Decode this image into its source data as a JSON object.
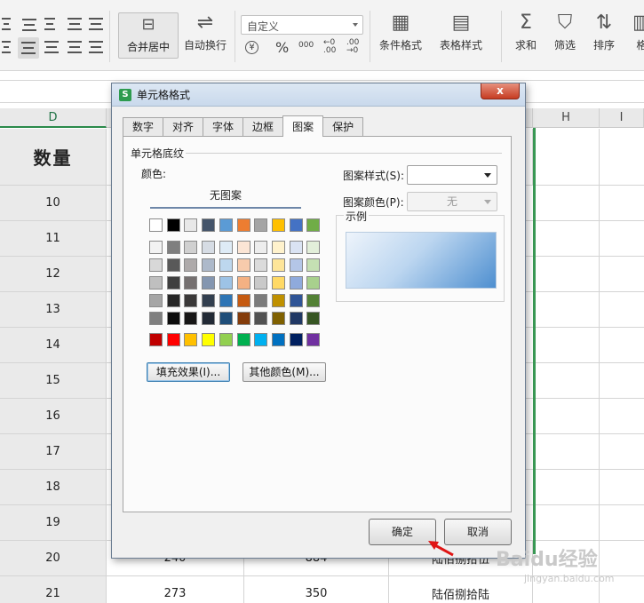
{
  "ribbon": {
    "merge_label": "合并居中",
    "autowrap_label": "自动换行",
    "number_format": "自定义",
    "currency_symbol": "¥",
    "percent_symbol": "%",
    "thousands_symbol": "000",
    "cond_format_label": "条件格式",
    "table_style_label": "表格样式",
    "sum_label": "求和",
    "filter_label": "筛选",
    "sort_label": "排序",
    "format_label": "格"
  },
  "columns": [
    "D",
    "H",
    "I"
  ],
  "sheet": {
    "header": "数量",
    "rows": [
      {
        "num": "10"
      },
      {
        "num": "11"
      },
      {
        "num": "12"
      },
      {
        "num": "13"
      },
      {
        "num": "14"
      },
      {
        "num": "15"
      },
      {
        "num": "16"
      },
      {
        "num": "17"
      },
      {
        "num": "18"
      },
      {
        "num": "19"
      },
      {
        "num": "20",
        "e": "240",
        "f": "884",
        "g": "陆佰捌拾伍"
      },
      {
        "num": "21",
        "e": "273",
        "f": "350",
        "g": "陆佰捌拾陆"
      }
    ]
  },
  "dialog": {
    "title": "单元格格式",
    "close": "x",
    "tabs": [
      "数字",
      "对齐",
      "字体",
      "边框",
      "图案",
      "保护"
    ],
    "active_tab": "图案",
    "group_title": "单元格底纹",
    "color_label": "颜色:",
    "no_pattern": "无图案",
    "palette": {
      "top": [
        "#ffffff",
        "#000000",
        "#e8e8e8",
        "#44546a",
        "#5b9bd5",
        "#ed7d31",
        "#a5a5a5",
        "#ffc000",
        "#4472c4",
        "#70ad47"
      ],
      "shades": [
        [
          "#f2f2f2",
          "#7f7f7f",
          "#d0d0d0",
          "#d6dce4",
          "#deebf6",
          "#fbe5d5",
          "#ededed",
          "#fff2cc",
          "#dae3f3",
          "#e2efda"
        ],
        [
          "#d8d8d8",
          "#595959",
          "#aeaaaa",
          "#adb9ca",
          "#bdd7ee",
          "#f7cbac",
          "#dbdbdb",
          "#fee599",
          "#b4c6e7",
          "#c5e0b3"
        ],
        [
          "#bfbfbf",
          "#3f3f3f",
          "#757070",
          "#8496b0",
          "#9dc3e6",
          "#f4b183",
          "#c9c9c9",
          "#ffd965",
          "#8faadc",
          "#a8d08d"
        ],
        [
          "#a5a5a5",
          "#262626",
          "#3a3838",
          "#323f4f",
          "#2e75b5",
          "#c55a11",
          "#7b7b7b",
          "#bf9000",
          "#2f5496",
          "#538135"
        ],
        [
          "#7f7f7f",
          "#0c0c0c",
          "#171616",
          "#222a35",
          "#1f4e79",
          "#843c0b",
          "#525252",
          "#7f6000",
          "#203864",
          "#375623"
        ]
      ],
      "standard": [
        "#c00000",
        "#ff0000",
        "#ffc000",
        "#ffff00",
        "#92d050",
        "#00b050",
        "#00b0f0",
        "#0070c0",
        "#002060",
        "#7030a0"
      ]
    },
    "fill_effects_btn": "填充效果(I)...",
    "more_colors_btn": "其他颜色(M)...",
    "pattern_style_label": "图案样式(S):",
    "pattern_color_label": "图案颜色(P):",
    "pattern_color_value": "无",
    "sample_label": "示例",
    "ok_btn": "确定",
    "cancel_btn": "取消"
  },
  "watermark": {
    "text": "Baidu经验",
    "sub": "jingyan.baidu.com"
  }
}
